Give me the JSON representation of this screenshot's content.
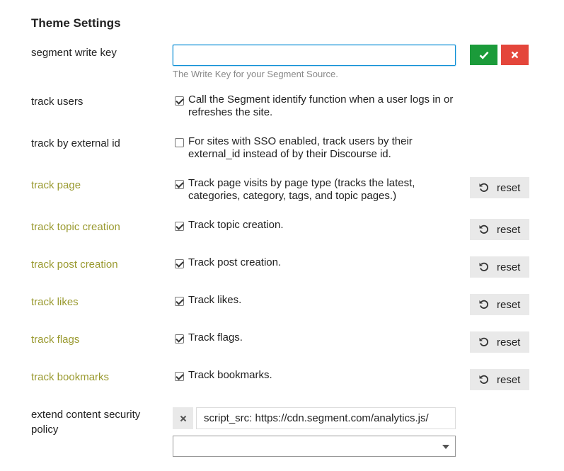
{
  "section_title": "Theme Settings",
  "segment_write_key": {
    "label": "segment write key",
    "value": "",
    "help": "The Write Key for your Segment Source.",
    "ok_icon": "check-icon",
    "cancel_icon": "x-icon"
  },
  "settings": [
    {
      "label": "track users",
      "checked": true,
      "modified": false,
      "description": "Call the Segment identify function when a user logs in or refreshes the site."
    },
    {
      "label": "track by external id",
      "checked": false,
      "modified": false,
      "description": "For sites with SSO enabled, track users by their external_id instead of by their Discourse id."
    },
    {
      "label": "track page",
      "checked": true,
      "modified": true,
      "description": "Track page visits by page type (tracks the latest, categories, category, tags, and topic pages.)"
    },
    {
      "label": "track topic creation",
      "checked": true,
      "modified": true,
      "description": "Track topic creation."
    },
    {
      "label": "track post creation",
      "checked": true,
      "modified": true,
      "description": "Track post creation."
    },
    {
      "label": "track likes",
      "checked": true,
      "modified": true,
      "description": "Track likes."
    },
    {
      "label": "track flags",
      "checked": true,
      "modified": true,
      "description": "Track flags."
    },
    {
      "label": "track bookmarks",
      "checked": true,
      "modified": true,
      "description": "Track bookmarks."
    }
  ],
  "reset_label": "reset",
  "reset_icon": "undo-icon",
  "extend_csp": {
    "label": "extend content security policy",
    "items": [
      "script_src: https://cdn.segment.com/analytics.js/"
    ],
    "remove_icon": "x-icon",
    "select_value": ""
  },
  "colors": {
    "modified_label": "#9a9a30",
    "ok_button": "#1b9b3a",
    "cancel_button": "#e4463b",
    "focus_border": "#0f90d6"
  }
}
